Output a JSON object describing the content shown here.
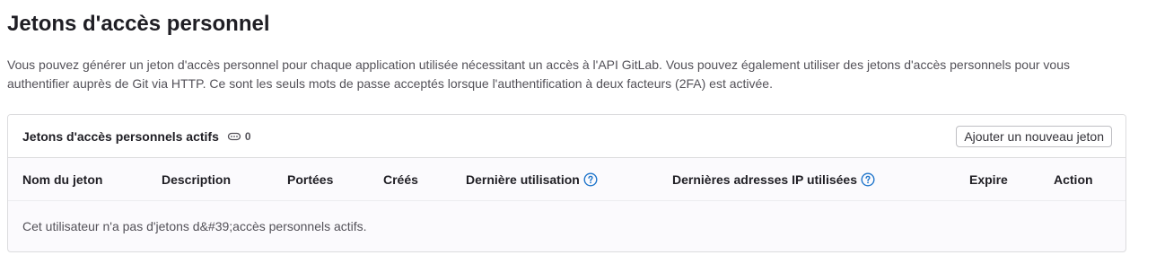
{
  "page": {
    "title": "Jetons d'accès personnel",
    "description": "Vous pouvez générer un jeton d'accès personnel pour chaque application utilisée nécessitant un accès à l'API GitLab. Vous pouvez également utiliser des jetons d'accès personnels pour vous authentifier auprès de Git via HTTP. Ce sont les seuls mots de passe acceptés lorsque l'authentification à deux facteurs (2FA) est activée."
  },
  "card": {
    "title": "Jetons d'accès personnels actifs",
    "count_icon": "token-icon",
    "count": "0",
    "add_button_label": "Ajouter un nouveau jeton"
  },
  "table": {
    "columns": {
      "name": "Nom du jeton",
      "description": "Description",
      "scopes": "Portées",
      "created": "Créés",
      "last_used": "Dernière utilisation",
      "last_ips": "Dernières adresses IP utilisées",
      "expires": "Expire",
      "action": "Action"
    },
    "help_icon": "question-circle-icon",
    "empty_message": "Cet utilisateur n'a pas d'jetons d&#39;accès personnels actifs."
  },
  "colors": {
    "help_icon": "#1f75cb",
    "border": "#dcdcde",
    "card_background": "#fbfafd"
  }
}
